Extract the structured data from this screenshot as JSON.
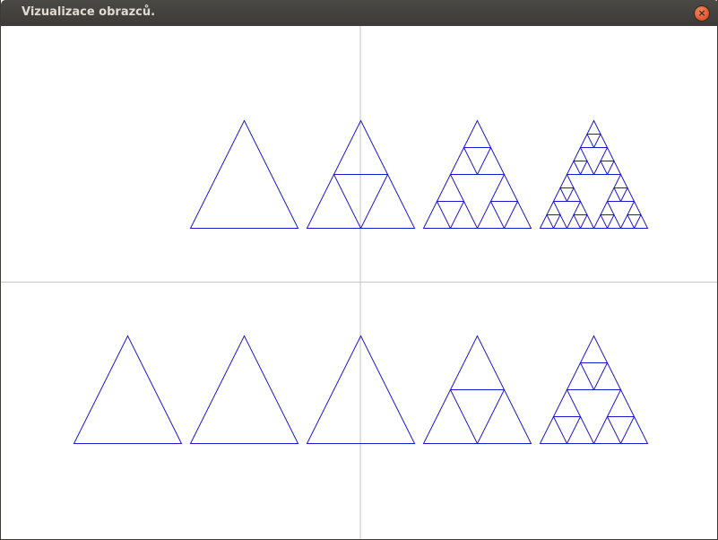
{
  "window": {
    "title": "Vizualizace obrazců.",
    "close_glyph": "×",
    "close_icon": "close-icon"
  },
  "colors": {
    "fractal_stroke": "#1a1acc",
    "axis_line": "#c6c6c6",
    "background": "#ffffff"
  },
  "rows": [
    {
      "name": "top-row",
      "levels": [
        0,
        1,
        2,
        3
      ]
    },
    {
      "name": "bottom-row",
      "levels": [
        0,
        0,
        0,
        1,
        2
      ]
    }
  ]
}
